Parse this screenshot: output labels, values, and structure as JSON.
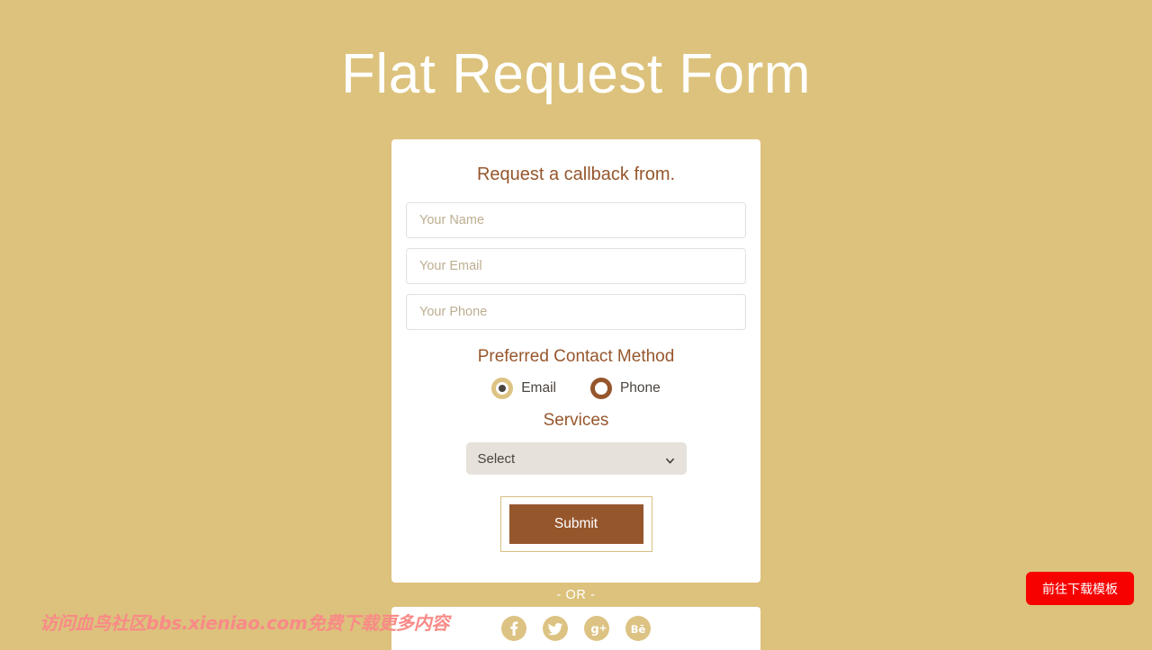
{
  "page": {
    "title": "Flat Request Form",
    "background_color": "#dcc27c",
    "title_color": "#ffffff"
  },
  "form_card": {
    "heading": "Request a callback from.",
    "heading_color": "#96562c",
    "fields": [
      {
        "name": "name",
        "placeholder": "Your Name",
        "value": ""
      },
      {
        "name": "email",
        "placeholder": "Your Email",
        "value": ""
      },
      {
        "name": "phone",
        "placeholder": "Your Phone",
        "value": ""
      }
    ],
    "contact_method": {
      "heading": "Preferred Contact Method",
      "options": [
        {
          "label": "Email",
          "selected": true,
          "ring_color": "#ddc383"
        },
        {
          "label": "Phone",
          "selected": false,
          "ring_color": "#96562c"
        }
      ]
    },
    "services": {
      "heading": "Services",
      "selected": "Select",
      "options": [
        "Select"
      ],
      "chevron_icon": "chevron-down-icon"
    },
    "submit": {
      "label": "Submit",
      "button_color": "#96562c",
      "frame_border_color": "#d6bf82"
    }
  },
  "divider": {
    "text": "- OR -"
  },
  "social": {
    "icons": [
      {
        "name": "facebook-icon",
        "label": "f"
      },
      {
        "name": "twitter-icon",
        "label": "t"
      },
      {
        "name": "google-plus-icon",
        "label": "g+"
      },
      {
        "name": "behance-icon",
        "label": "Be"
      }
    ],
    "circle_color": "#ddc383"
  },
  "overlays": {
    "watermark_text": "访问血鸟社区bbs.xieniao.com免费下载更多内容",
    "watermark_color": "#f98a87",
    "download_button_label": "前往下载模板",
    "download_button_color": "#f60000"
  }
}
